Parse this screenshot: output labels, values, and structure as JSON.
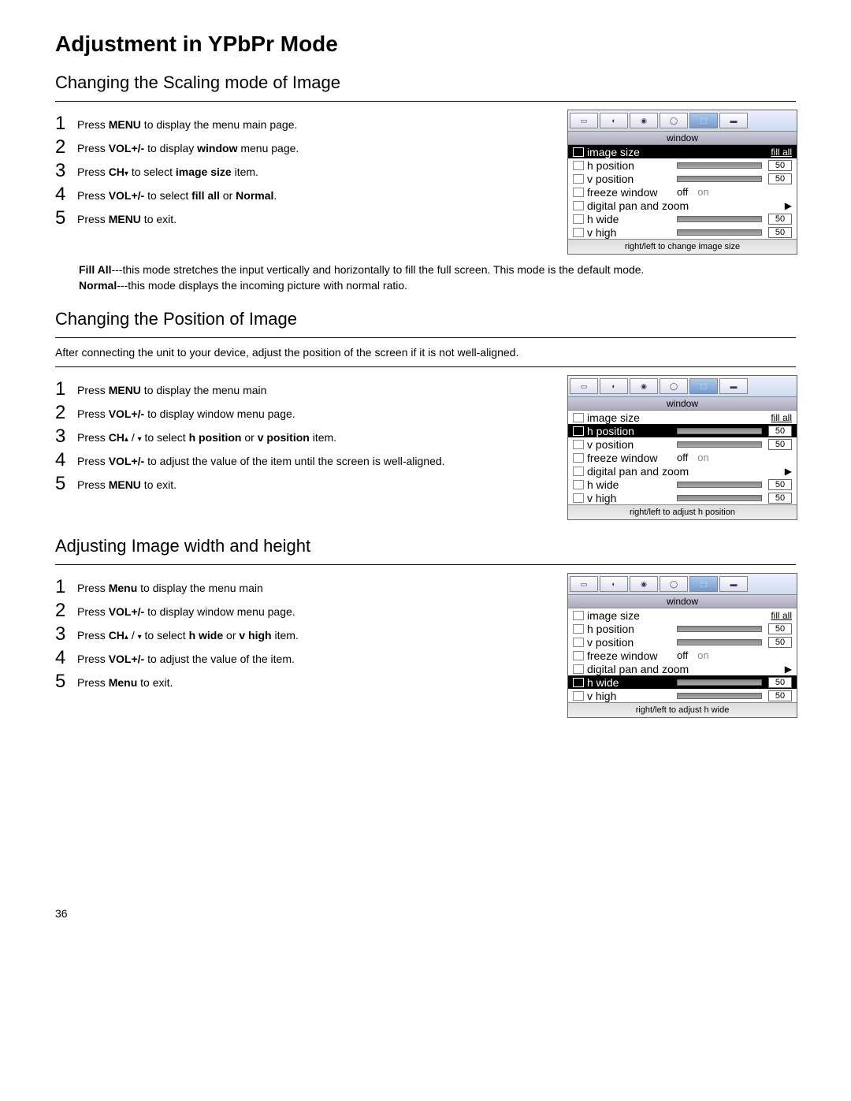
{
  "page_title": "Adjustment in YPbPr Mode",
  "page_number": "36",
  "section1": {
    "heading": "Changing the Scaling mode of Image",
    "steps": {
      "s1": [
        "Press ",
        "MENU",
        " to display the menu main page."
      ],
      "s2": [
        "Press ",
        "VOL+/-",
        " to display ",
        "window",
        " menu page."
      ],
      "s3": [
        "Press ",
        "CH",
        " to select ",
        "image size",
        " item."
      ],
      "s4": [
        "Press ",
        "VOL+/-",
        " to select ",
        "fill all",
        " or ",
        "Normal",
        "."
      ],
      "s5": [
        "Press ",
        "MENU",
        " to exit."
      ]
    },
    "desc_fillall_label": "Fill All",
    "desc_fillall": "---this mode stretches the input vertically and horizontally to fill the full screen. This mode is the default mode.",
    "desc_normal_label": "Normal",
    "desc_normal": "---this mode displays the incoming picture with normal ratio."
  },
  "section2": {
    "heading": "Changing the Position of Image",
    "intro": "After connecting the unit to your device, adjust the position of the screen if it is not well-aligned.",
    "steps": {
      "s1": [
        "Press ",
        "MENU",
        " to display the menu main"
      ],
      "s2": [
        "Press ",
        "VOL+/-",
        " to display window menu page."
      ],
      "s3": [
        "Press ",
        "CH",
        " / ",
        " to select ",
        "h position",
        " or ",
        "v position",
        " item."
      ],
      "s4": [
        "Press ",
        "VOL+/-",
        " to adjust the value of the item until the screen is well-aligned."
      ],
      "s5": [
        "Press ",
        "MENU",
        " to exit."
      ]
    }
  },
  "section3": {
    "heading": "Adjusting Image width and height",
    "steps": {
      "s1": [
        "Press ",
        "Menu",
        " to display the menu main"
      ],
      "s2": [
        "Press ",
        "VOL+/-",
        " to display window menu page."
      ],
      "s3": [
        "Press ",
        "CH",
        " / ",
        " to select ",
        "h wide",
        " or ",
        "v high",
        " item."
      ],
      "s4": [
        "Press ",
        "VOL+/-",
        " to adjust the value of the item."
      ],
      "s5": [
        "Press ",
        "Menu",
        " to exit."
      ]
    }
  },
  "osd": {
    "title": "window",
    "image_size_label": "image size",
    "image_size_value": "fill all",
    "h_position_label": "h position",
    "h_position_value": "50",
    "v_position_label": "v position",
    "v_position_value": "50",
    "freeze_label": "freeze window",
    "freeze_off": "off",
    "freeze_on": "on",
    "dpz_label": "digital pan and zoom",
    "h_wide_label": "h wide",
    "h_wide_value": "50",
    "v_high_label": "v high",
    "v_high_value": "50",
    "hint1": "right/left to change image size",
    "hint2": "right/left to adjust h position",
    "hint3": "right/left to adjust h wide"
  }
}
